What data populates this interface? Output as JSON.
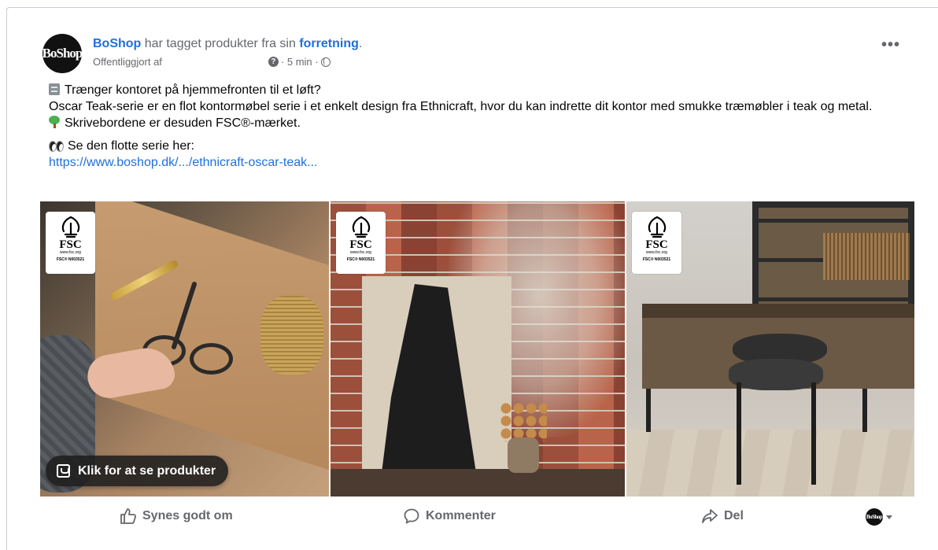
{
  "post": {
    "page_name": "BoShop",
    "headline_middle": " har tagget produkter fra sin ",
    "headline_link": "forretning",
    "headline_end": ".",
    "published_by": "Offentliggjort af",
    "time": "· 5 min ·",
    "more_label": "•••",
    "avatar_text": "BoShop",
    "text": {
      "line1": "Trænger kontoret på hjemmefronten til et løft?",
      "line2": "Oscar Teak-serie er en flot kontormøbel serie i et enkelt design fra Ethnicraft, hvor du kan indrette dit kontor med smukke træmøbler i teak og metal.",
      "line3": "Skrivebordene er desuden FSC®-mærket.",
      "line4": "Se den flotte serie her:",
      "link": "https://www.boshop.dk/.../ethnicraft-oscar-teak..."
    }
  },
  "fsc_badge": {
    "title": "FSC",
    "site": "www.fsc.org",
    "code": "FSC® N003521"
  },
  "product_pill": {
    "label": "Klik for at se produkter"
  },
  "actions": {
    "like": "Synes godt om",
    "comment": "Kommenter",
    "share": "Del"
  },
  "account": {
    "avatar_text": "BoShop"
  },
  "colors": {
    "link": "#216fdb",
    "muted": "#65676b",
    "text": "#050505"
  },
  "icons": [
    "question-icon",
    "globe-icon",
    "more-icon",
    "cabinet-emoji",
    "tree-emoji",
    "eyes-emoji",
    "fsc-logo",
    "shopping-bag-icon",
    "thumbs-up-icon",
    "comment-icon",
    "share-icon",
    "caret-down-icon"
  ]
}
